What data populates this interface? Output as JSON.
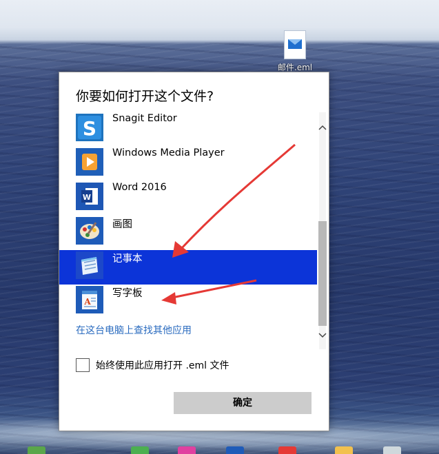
{
  "desktop": {
    "file_icon": "email-file-icon",
    "file_label": "邮件.eml"
  },
  "dialog": {
    "title": "你要如何打开这个文件?",
    "apps": [
      {
        "name": "Snagit Editor",
        "icon": "snagit-icon"
      },
      {
        "name": "Windows Media Player",
        "icon": "media-player-icon"
      },
      {
        "name": "Word 2016",
        "icon": "word-icon"
      },
      {
        "name": "画图",
        "icon": "paint-icon"
      },
      {
        "name": "记事本",
        "icon": "notepad-icon",
        "selected": true
      },
      {
        "name": "写字板",
        "icon": "wordpad-icon"
      }
    ],
    "more_apps_link": "在这台电脑上查找其他应用",
    "always_use_label": "始终使用此应用打开 .eml 文件",
    "always_use_checked": false,
    "ok_label": "确定"
  },
  "colors": {
    "selection": "#0c34d8",
    "link": "#2a6bbf",
    "arrow": "#e53935"
  }
}
